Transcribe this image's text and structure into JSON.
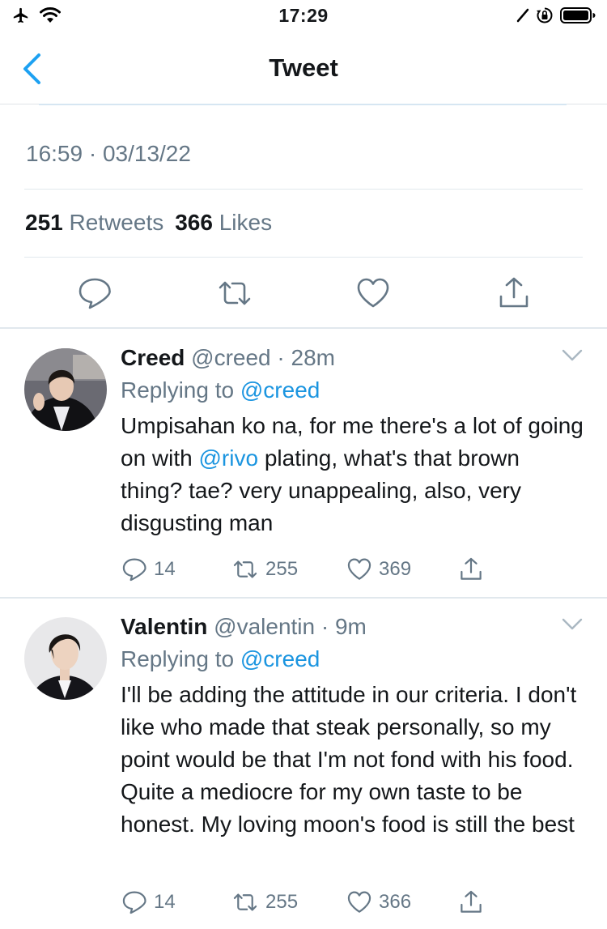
{
  "status_bar": {
    "time": "17:29",
    "icons": [
      "airplane-icon",
      "wifi-icon",
      "location-arrow-icon",
      "orientation-lock-icon",
      "battery-icon"
    ]
  },
  "nav": {
    "title": "Tweet",
    "back_icon": "chevron-left-icon"
  },
  "tweet": {
    "timestamp": "16:59 · 03/13/22",
    "retweets_count": "251",
    "retweets_label": "Retweets",
    "likes_count": "366",
    "likes_label": "Likes",
    "actions": [
      "reply-icon",
      "retweet-icon",
      "like-icon",
      "share-icon"
    ]
  },
  "replies": [
    {
      "name": "Creed",
      "handle": "@creed",
      "time": "· 28m",
      "replying_prefix": "Replying to",
      "replying_to": "@creed",
      "body_before": "Umpisahan ko na, for me there's a lot of going on with ",
      "body_mention": "@rivo",
      "body_after": " plating, what's that brown thing? tae? very unappealing, also, very disgusting man",
      "replies": "14",
      "retweets": "255",
      "likes": "369"
    },
    {
      "name": "Valentin",
      "handle": "@valentin",
      "time": "· 9m",
      "replying_prefix": "Replying to",
      "replying_to": "@creed",
      "body_before": "I'll be adding the attitude in our criteria. I don't like who made that steak personally, so my point would be that I'm not fond with his food. Quite a mediocre for my own taste to be honest. My loving moon's food is still the best",
      "body_mention": "",
      "body_after": "",
      "replies": "14",
      "retweets": "255",
      "likes": "366"
    }
  ],
  "colors": {
    "accent": "#1da1f2",
    "link": "#1b95e0",
    "secondary_text": "#657786",
    "primary_text": "#14171a",
    "divider": "#e1e8ed"
  }
}
